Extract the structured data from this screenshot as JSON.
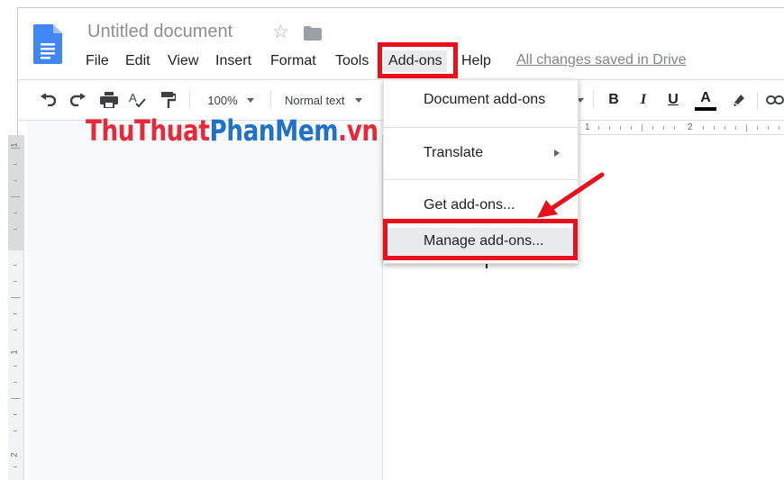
{
  "document": {
    "title": "Untitled document",
    "star_icon": "star-icon",
    "folder_icon": "folder-icon",
    "doc_icon": "google-docs-icon"
  },
  "menu": {
    "items": [
      "File",
      "Edit",
      "View",
      "Insert",
      "Format",
      "Tools",
      "Add-ons",
      "Help"
    ],
    "active": "Add-ons",
    "saved_status": "All changes saved in Drive"
  },
  "toolbar": {
    "zoom": "100%",
    "style": "Normal text",
    "icons": [
      "undo-icon",
      "redo-icon",
      "print-icon",
      "spellcheck-icon",
      "paint-format-icon",
      "zoom-dropdown",
      "style-dropdown",
      "bold-icon",
      "italic-icon",
      "underline-icon",
      "text-color-icon",
      "highlight-icon",
      "link-icon"
    ],
    "bold": "B",
    "italic": "I",
    "underline": "U",
    "text_color": "A"
  },
  "ruler": {
    "horizontal_numbers": [
      "1",
      "2"
    ],
    "vertical_numbers": [
      "1",
      "1",
      "2"
    ]
  },
  "dropdown": {
    "items": [
      {
        "label": "Document add-ons",
        "has_submenu": false
      },
      {
        "label": "Translate",
        "has_submenu": true
      },
      {
        "label": "Get add-ons...",
        "has_submenu": false
      },
      {
        "label": "Manage add-ons...",
        "has_submenu": false,
        "highlighted": true
      }
    ]
  },
  "watermark": {
    "part1": "ThuThuat",
    "part2": "PhanMem",
    "part3": ".vn"
  },
  "colors": {
    "annotation_red": "#e8101c",
    "watermark_red": "#e52b3a",
    "watermark_blue": "#1f72c7",
    "doc_blue": "#4285f4"
  }
}
